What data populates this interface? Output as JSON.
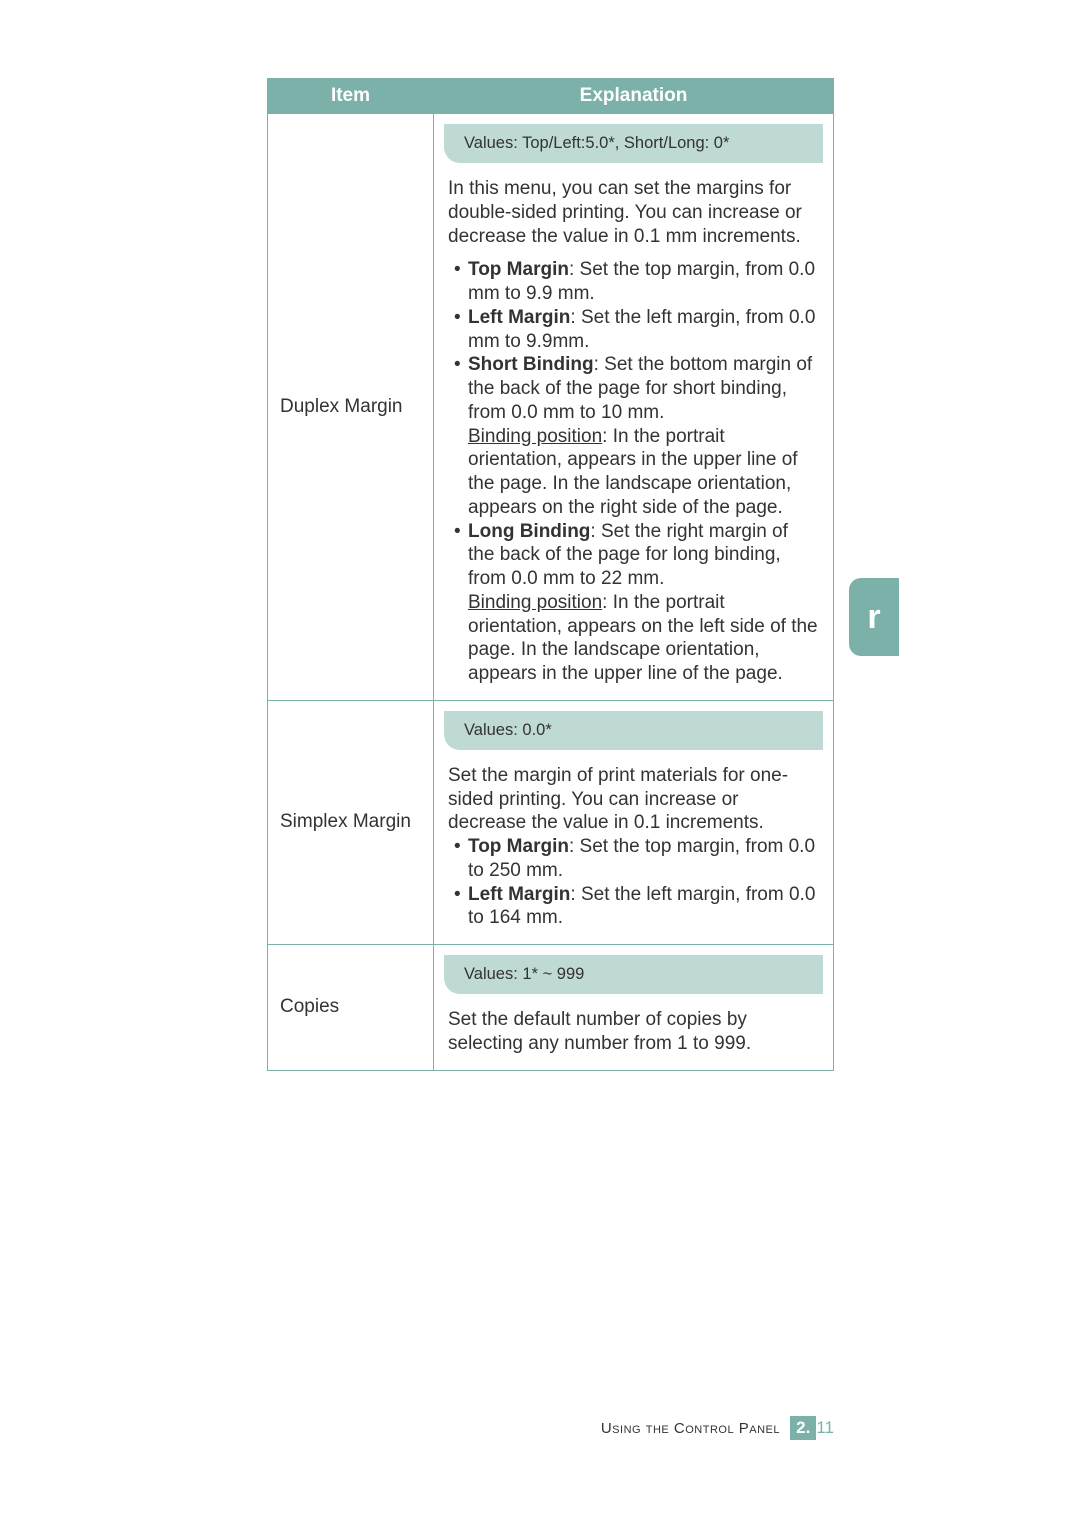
{
  "headers": {
    "item": "Item",
    "explanation": "Explanation"
  },
  "side_tab": "r",
  "rows": {
    "duplex": {
      "item": "Duplex Margin",
      "values": "Values: Top/Left:5.0*, Short/Long: 0*",
      "intro": "In this menu, you can set the margins for double-sided printing. You can increase or decrease the value in 0.1 mm increments.",
      "top_label": "Top Margin",
      "top_text": ": Set the top margin, from 0.0 mm to 9.9 mm.",
      "left_label": "Left Margin",
      "left_text": ": Set the left margin, from 0.0 mm to 9.9mm.",
      "short_label": "Short Binding",
      "short_text": ": Set the bottom margin of the back of the page for short binding, from 0.0 mm to 10 mm.",
      "bp_label": "Binding position",
      "short_bp": ": In the portrait orientation, appears in the upper line of the page. In the landscape orientation, appears on the right side of the page.",
      "long_label": "Long Binding",
      "long_text": ": Set the right margin of the back of the page for long binding, from 0.0 mm to 22 mm.",
      "long_bp": ": In the portrait orientation, appears on the left side of the page. In the landscape orientation, appears in the upper line of the page."
    },
    "simplex": {
      "item": "Simplex Margin",
      "values": "Values: 0.0*",
      "intro": "Set the margin of print materials for one-sided printing. You can increase or decrease the value in 0.1 increments.",
      "top_label": "Top Margin",
      "top_text": ": Set the top margin, from 0.0 to 250 mm.",
      "left_label": "Left Margin",
      "left_text": ": Set the left margin, from 0.0 to 164 mm."
    },
    "copies": {
      "item": "Copies",
      "values": "Values: 1* ~ 999",
      "text": "Set the default number of copies by selecting any number from 1 to 999."
    }
  },
  "footer": {
    "text": "Using the Control Panel",
    "chapter": "2.",
    "page": "11"
  }
}
